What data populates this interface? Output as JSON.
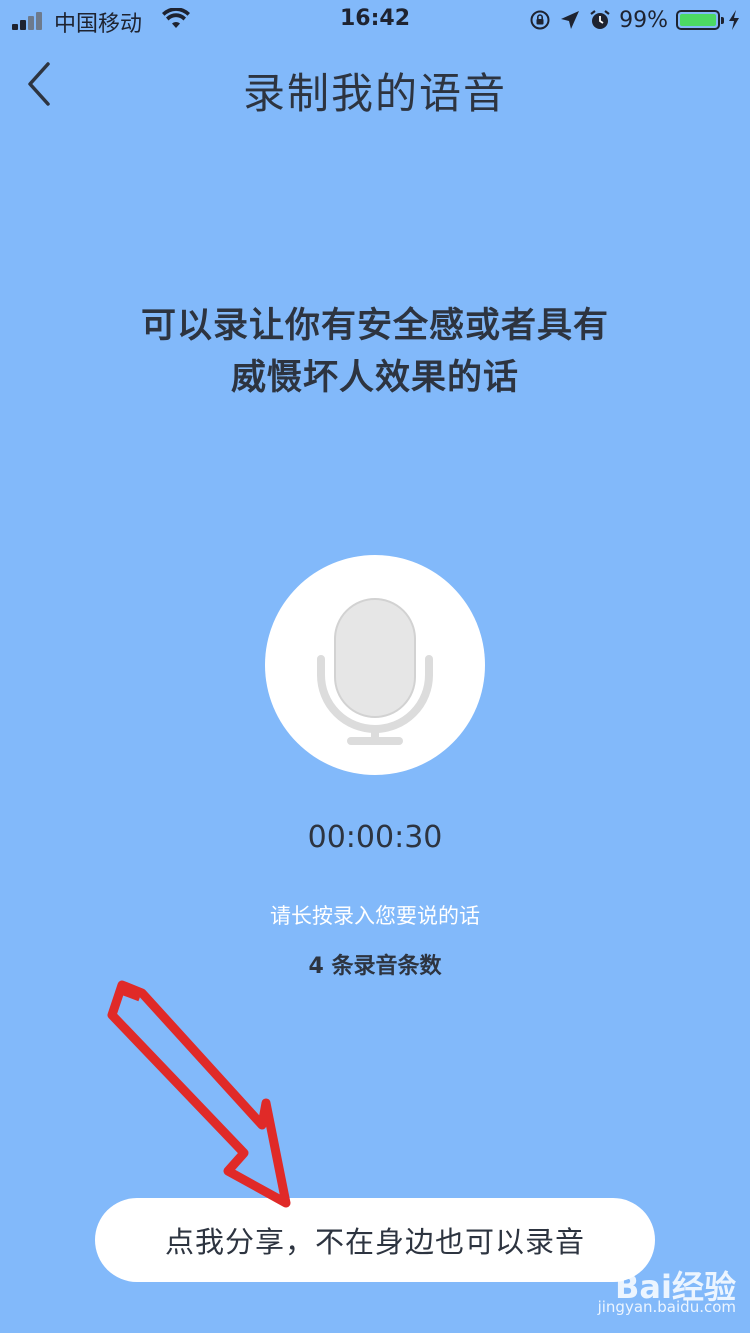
{
  "status_bar": {
    "carrier": "中国移动",
    "time": "16:42",
    "battery_percent": "99%",
    "icons": [
      "signal-icon",
      "wifi-icon",
      "rotation-lock-icon",
      "location-arrow-icon",
      "alarm-icon",
      "battery-icon",
      "charging-bolt-icon"
    ]
  },
  "nav": {
    "back_icon": "chevron-left-icon",
    "title": "录制我的语音"
  },
  "main": {
    "description_line1": "可以录让你有安全感或者具有",
    "description_line2": "威慑坏人效果的话",
    "mic_icon": "microphone-icon",
    "timer": "00:00:30",
    "hint": "请长按录入您要说的话",
    "record_count": "4 条录音条数"
  },
  "share": {
    "label": "点我分享，不在身边也可以录音"
  },
  "watermark": {
    "logo": "Bai经验",
    "url": "jingyan.baidu.com"
  },
  "colors": {
    "background": "#82b9fa",
    "text_dark": "#2d3440",
    "button_bg": "#ffffff",
    "mic_gray": "#e6e6e6",
    "annotation_red": "#e02a28",
    "battery_green": "#4cd964"
  }
}
